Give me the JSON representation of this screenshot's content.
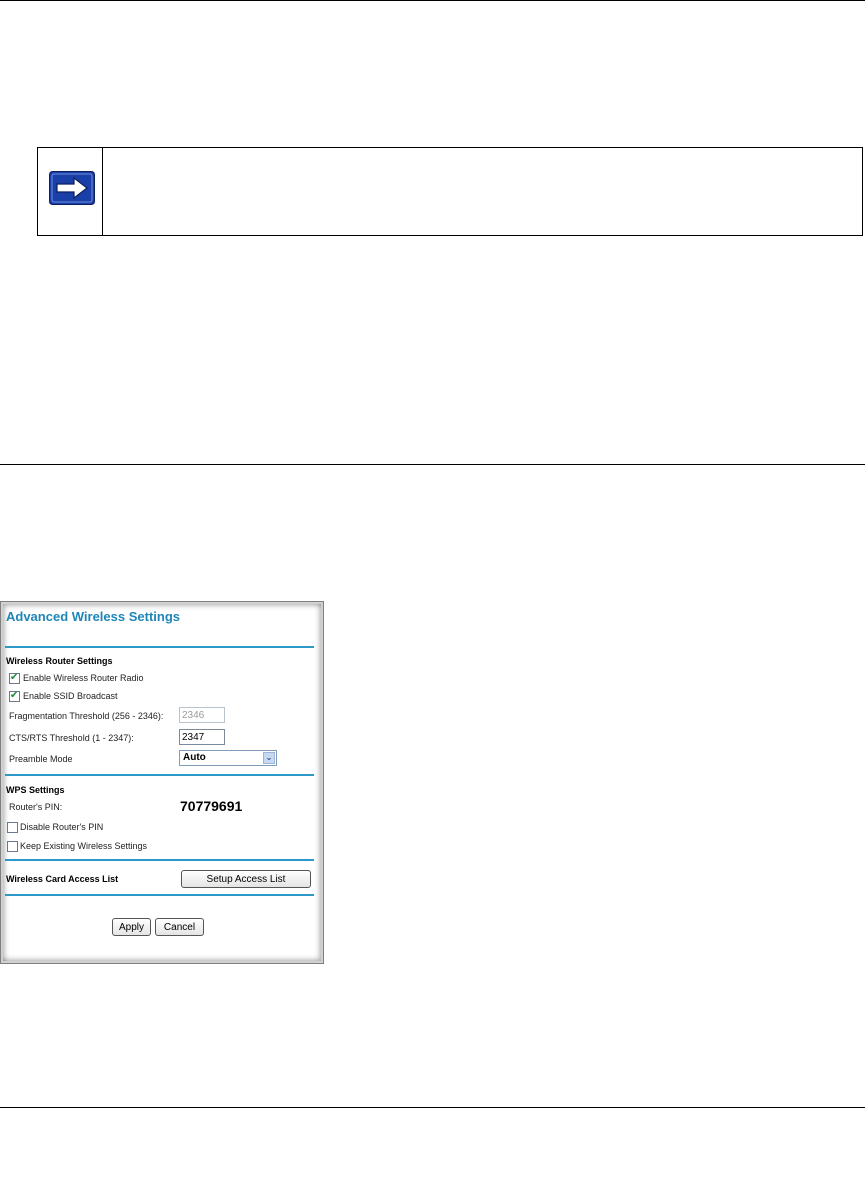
{
  "panel": {
    "title": "Advanced Wireless Settings",
    "router_settings": {
      "heading": "Wireless Router Settings",
      "enable_radio": {
        "label": "Enable Wireless Router Radio",
        "checked": true
      },
      "enable_ssid": {
        "label": "Enable SSID Broadcast",
        "checked": true
      },
      "frag_threshold": {
        "label": "Fragmentation Threshold (256 - 2346):",
        "value": "2346"
      },
      "cts_threshold": {
        "label": "CTS/RTS Threshold (1 - 2347):",
        "value": "2347"
      },
      "preamble": {
        "label": "Preamble Mode",
        "value": "Auto"
      }
    },
    "wps": {
      "heading": "WPS Settings",
      "pin_label": "Router's PIN:",
      "pin_value": "70779691",
      "disable_pin": {
        "label": "Disable Router's PIN",
        "checked": false
      },
      "keep_existing": {
        "label": "Keep Existing Wireless Settings",
        "checked": false
      }
    },
    "access_list": {
      "label": "Wireless Card Access List",
      "button": "Setup Access List"
    },
    "buttons": {
      "apply": "Apply",
      "cancel": "Cancel"
    }
  },
  "icons": {
    "note": "right-arrow-icon"
  },
  "colors": {
    "accent": "#2c99c9",
    "title": "#1f86b8",
    "arrow_icon": "#1b3fa8"
  }
}
